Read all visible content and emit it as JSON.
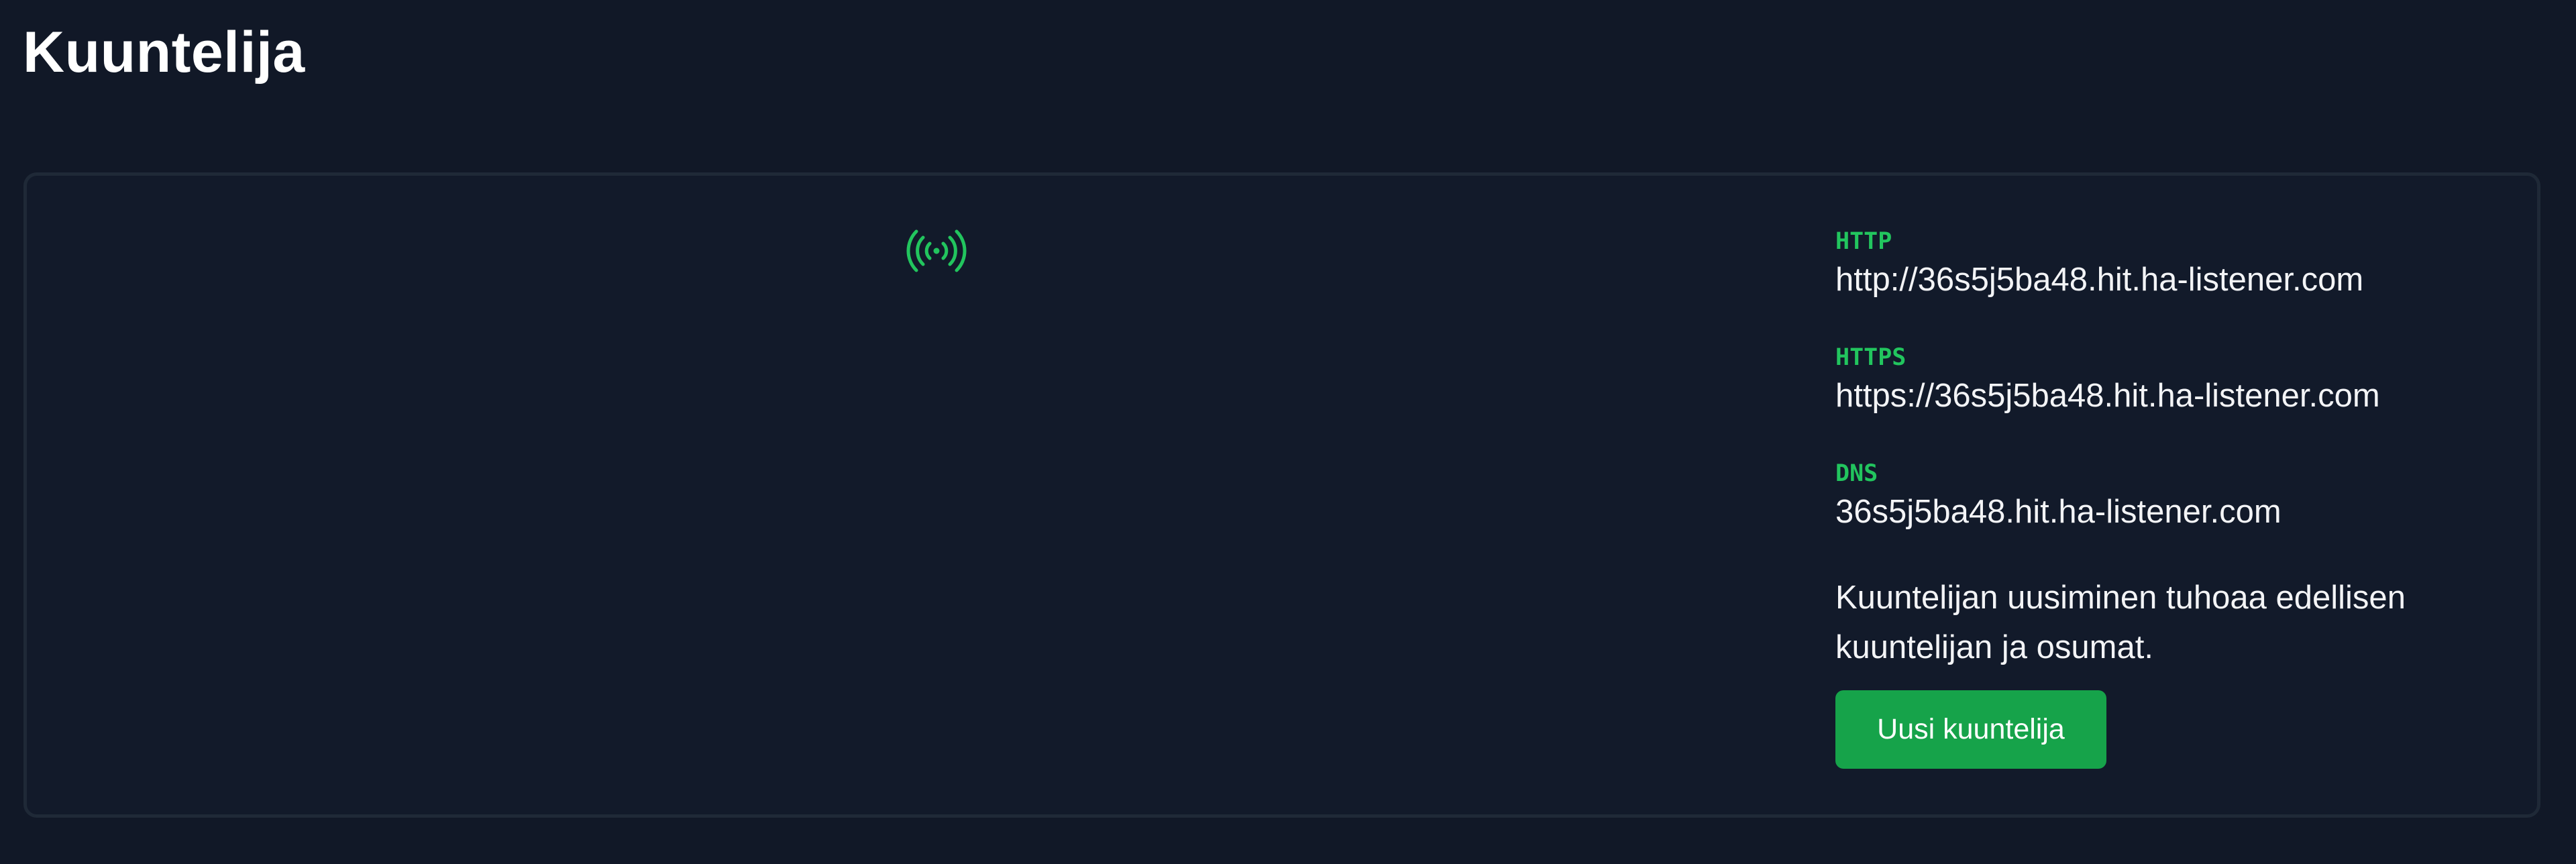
{
  "page": {
    "title": "Kuuntelija"
  },
  "listener": {
    "status_icon": "broadcast-signal-icon",
    "accent_color": "#22c55e",
    "button_color": "#16a34a",
    "endpoints": [
      {
        "label": "HTTP",
        "value": "http://36s5j5ba48.hit.ha-listener.com"
      },
      {
        "label": "HTTPS",
        "value": "https://36s5j5ba48.hit.ha-listener.com"
      },
      {
        "label": "DNS",
        "value": "36s5j5ba48.hit.ha-listener.com"
      }
    ],
    "warning": "Kuuntelijan uusiminen tuhoaa edellisen kuuntelijan ja osumat.",
    "new_button_label": "Uusi kuuntelija"
  }
}
